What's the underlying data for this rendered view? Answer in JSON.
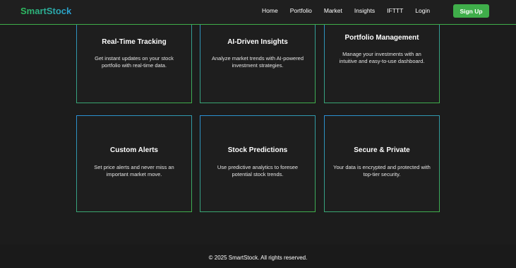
{
  "nav": {
    "brand": "SmartStock",
    "links": [
      "Home",
      "Portfolio",
      "Market",
      "Insights",
      "IFTTT",
      "Login"
    ],
    "signup_label": "Sign Up"
  },
  "features": [
    {
      "title": "Real-Time Tracking",
      "desc": "Get instant updates on your stock portfolio with real-time data."
    },
    {
      "title": "AI-Driven Insights",
      "desc": "Analyze market trends with AI-powered investment strategies."
    },
    {
      "title": "Portfolio Management",
      "desc": "Manage your investments with an intuitive and easy-to-use dashboard."
    },
    {
      "title": "Custom Alerts",
      "desc": "Set price alerts and never miss an important market move."
    },
    {
      "title": "Stock Predictions",
      "desc": "Use predictive analytics to foresee potential stock trends."
    },
    {
      "title": "Secure & Private",
      "desc": "Your data is encrypted and protected with top-tier security."
    }
  ],
  "footer": {
    "text": "© 2025 SmartStock. All rights reserved."
  },
  "colors": {
    "accent": "#3fae4a",
    "blue": "#2a9fd6",
    "background": "#1c1c1c"
  }
}
